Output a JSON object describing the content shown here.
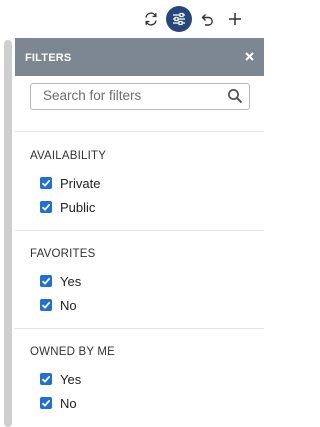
{
  "panel": {
    "title": "FILTERS"
  },
  "search": {
    "placeholder": "Search for filters"
  },
  "sections": [
    {
      "title": "AVAILABILITY",
      "options": [
        {
          "label": "Private",
          "checked": true
        },
        {
          "label": "Public",
          "checked": true
        }
      ]
    },
    {
      "title": "FAVORITES",
      "options": [
        {
          "label": "Yes",
          "checked": true
        },
        {
          "label": "No",
          "checked": true
        }
      ]
    },
    {
      "title": "OWNED BY ME",
      "options": [
        {
          "label": "Yes",
          "checked": true
        },
        {
          "label": "No",
          "checked": true
        }
      ]
    }
  ],
  "colors": {
    "accent": "#26477c",
    "header": "#7d8792",
    "checkbox": "#1f6fd6"
  }
}
